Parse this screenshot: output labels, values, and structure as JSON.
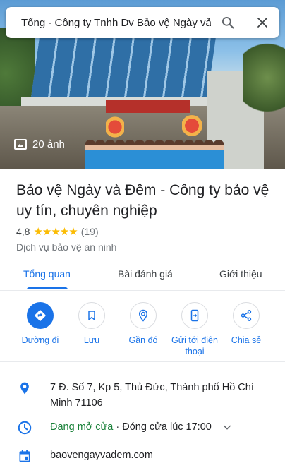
{
  "search": {
    "query": "Tổng - Công ty Tnhh Dv Bảo vệ Ngày vả"
  },
  "hero": {
    "photo_count": "20 ảnh"
  },
  "place": {
    "title": "Bảo vệ Ngày và Đêm - Công ty bảo vệ uy tín, chuyên nghiệp",
    "rating": "4,8",
    "stars": "★★★★★",
    "review_count": "(19)",
    "category": "Dịch vụ bảo vệ an ninh"
  },
  "tabs": [
    {
      "label": "Tổng quan"
    },
    {
      "label": "Bài đánh giá"
    },
    {
      "label": "Giới thiệu"
    }
  ],
  "actions": [
    {
      "label": "Đường đi",
      "icon": "directions-icon"
    },
    {
      "label": "Lưu",
      "icon": "bookmark-icon"
    },
    {
      "label": "Gần đó",
      "icon": "nearby-icon"
    },
    {
      "label": "Gửi tới điện thoại",
      "icon": "send-to-phone-icon"
    },
    {
      "label": "Chia sẻ",
      "icon": "share-icon"
    }
  ],
  "info": {
    "address": "7 Đ. Số 7, Kp 5, Thủ Đức, Thành phố Hồ Chí Minh 71106",
    "status_open": "Đang mở cửa",
    "status_sep": " · ",
    "status_close": "Đóng cửa lúc 17:00",
    "website": "baovengayvadem.com"
  },
  "colors": {
    "accent": "#1a73e8",
    "star": "#fbbc04",
    "open": "#188038"
  }
}
